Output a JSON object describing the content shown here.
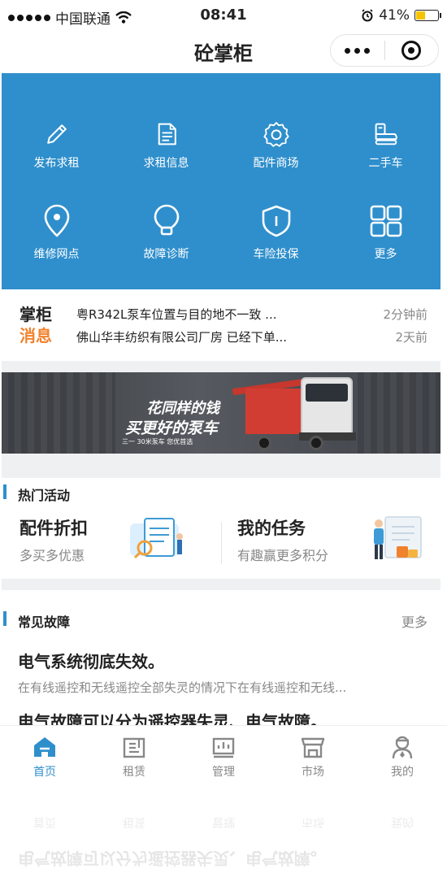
{
  "status_bar": {
    "carrier": "中国联通",
    "time": "08:41",
    "battery": "41%"
  },
  "nav": {
    "title": "砼掌柜"
  },
  "grid": [
    {
      "label": "发布求租",
      "icon": "pencil-icon"
    },
    {
      "label": "求租信息",
      "icon": "document-icon"
    },
    {
      "label": "配件商场",
      "icon": "gear-icon"
    },
    {
      "label": "二手车",
      "icon": "truck-icon"
    },
    {
      "label": "维修网点",
      "icon": "location-pin-icon"
    },
    {
      "label": "故障诊断",
      "icon": "lightbulb-icon"
    },
    {
      "label": "车险投保",
      "icon": "shield-icon"
    },
    {
      "label": "更多",
      "icon": "grid-more-icon"
    }
  ],
  "news": {
    "logo_line1": "掌柜",
    "logo_line2": "消息",
    "items": [
      {
        "text": "粤R342L泵车位置与目的地不一致 ...",
        "time": "2分钟前"
      },
      {
        "text": "佛山华丰纺织有限公司厂房 已经下单...",
        "time": "2天前"
      }
    ]
  },
  "banner": {
    "slogan_line1": "花同样的钱",
    "slogan_line2": "买更好的泵车",
    "slogan_line3": "三一 30米泵车 您优首选"
  },
  "activities": {
    "title": "热门活动",
    "cards": [
      {
        "title": "配件折扣",
        "subtitle": "多买多优惠"
      },
      {
        "title": "我的任务",
        "subtitle": "有趣赢更多积分"
      }
    ]
  },
  "faults": {
    "title": "常见故障",
    "more": "更多",
    "items": [
      {
        "title": "电气系统彻底失效。",
        "desc": "在有线遥控和无线遥控全部失灵的情况下在有线遥控和无线..."
      },
      {
        "title": "电气故障可以分为遥控器失灵、电气故障。",
        "desc": ""
      }
    ]
  },
  "tabbar": [
    {
      "label": "首页",
      "icon": "home-icon",
      "active": true
    },
    {
      "label": "租赁",
      "icon": "lease-icon",
      "active": false
    },
    {
      "label": "管理",
      "icon": "manage-icon",
      "active": false
    },
    {
      "label": "市场",
      "icon": "market-icon",
      "active": false
    },
    {
      "label": "我的",
      "icon": "profile-icon",
      "active": false
    }
  ],
  "colors": {
    "primary_blue": "#2f8fcc",
    "accent_orange": "#f0822d"
  }
}
